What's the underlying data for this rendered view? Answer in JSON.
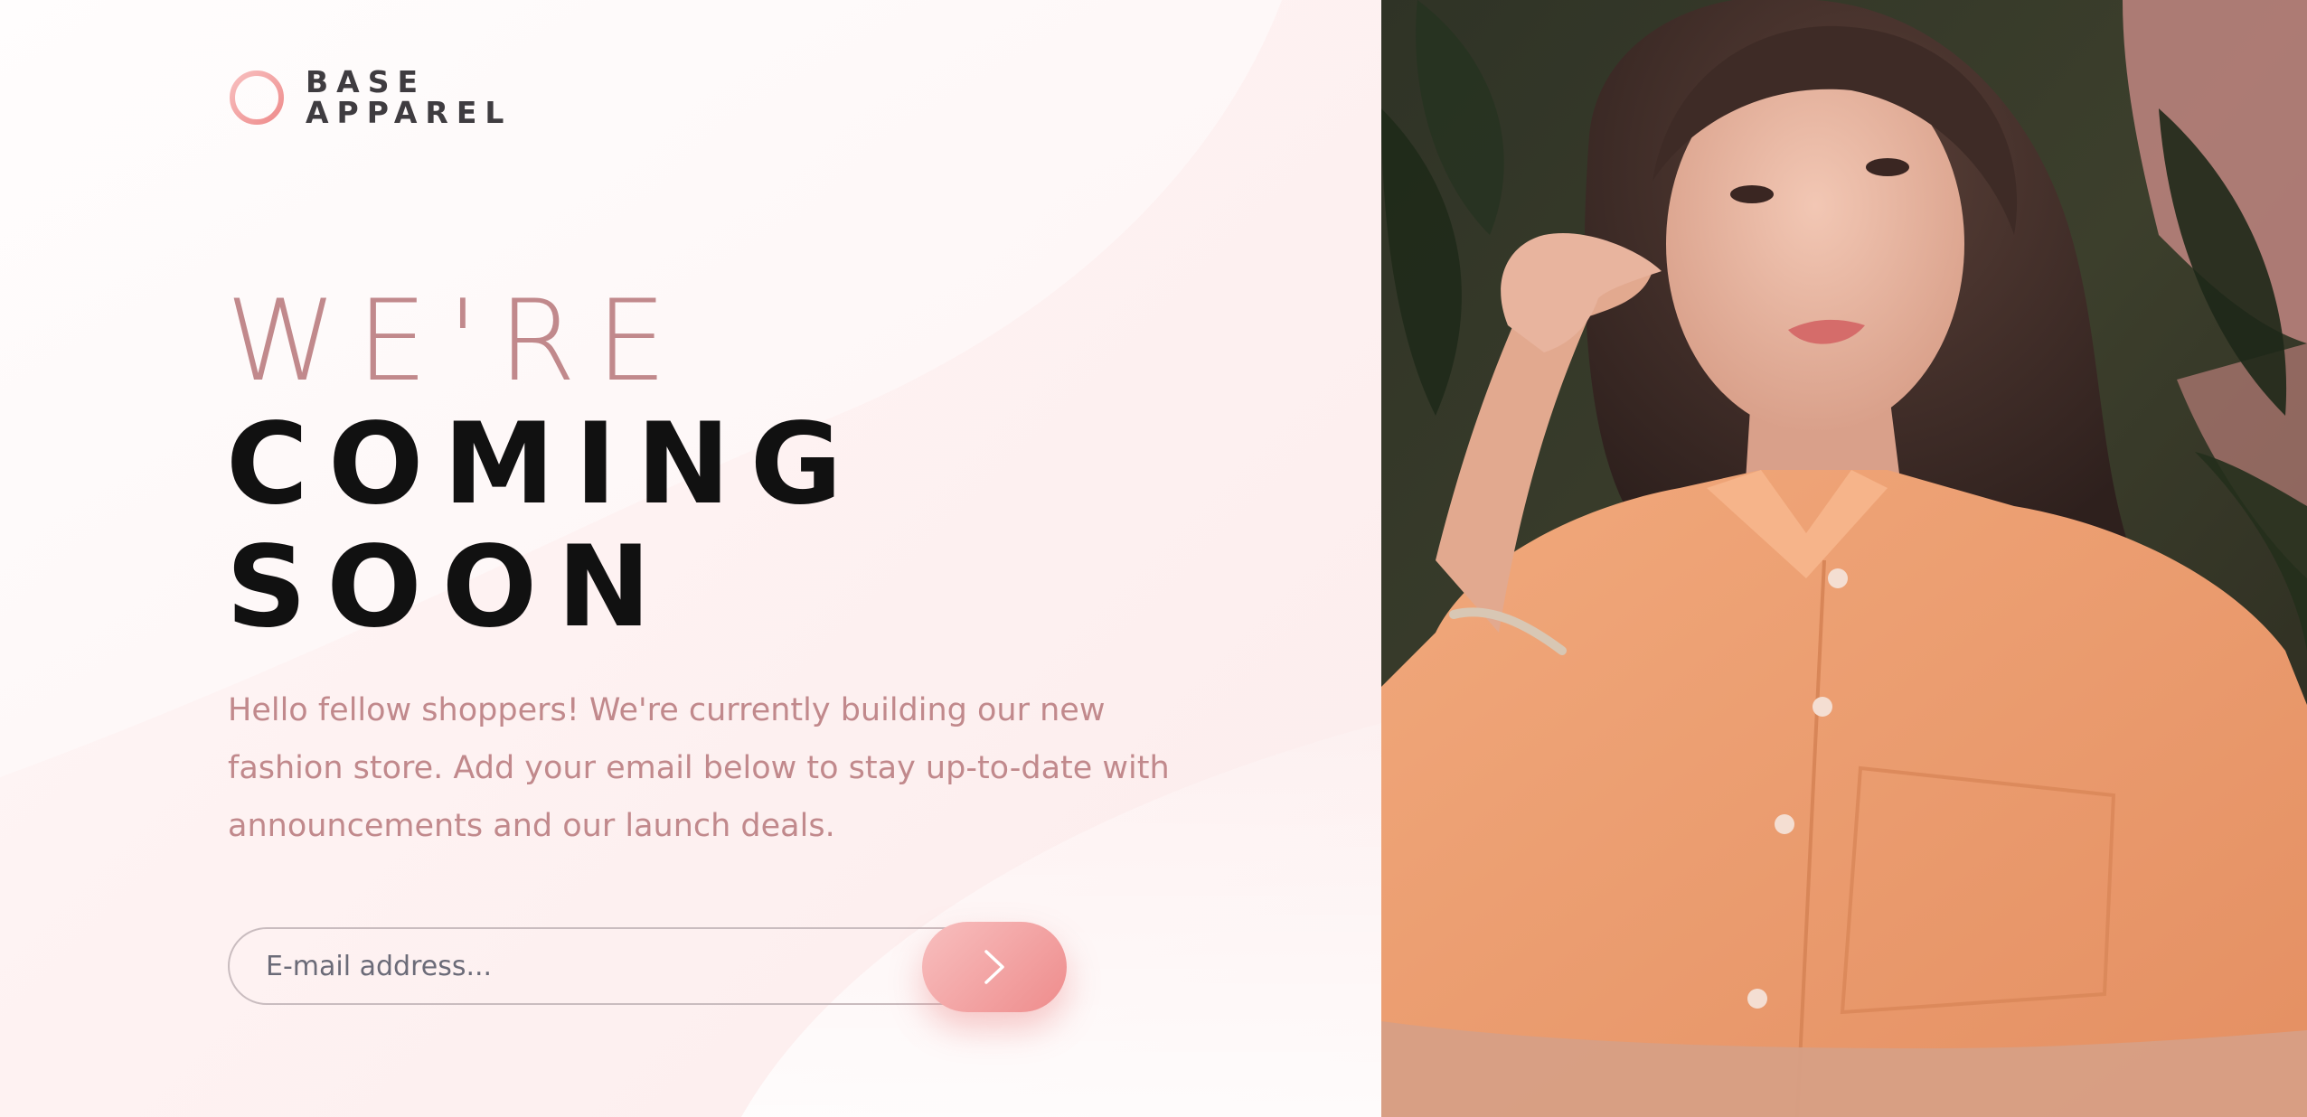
{
  "brand": {
    "line1": "BASE",
    "line2": "APPAREL",
    "logo_icon": "ring-icon"
  },
  "headline": {
    "light": "WE'RE",
    "bold_line1": "COMING",
    "bold_line2": "SOON"
  },
  "description": "Hello fellow shoppers! We're currently building our new fashion store. Add your email below to stay up-to-date with announcements and our launch deals.",
  "form": {
    "email_placeholder": "E-mail address...",
    "email_value": "",
    "submit_icon": "chevron-right-icon"
  },
  "colors": {
    "accent": "#ee8c8c",
    "accent_light": "#f8bfbf",
    "desaturated_red": "#c1898c",
    "dark": "#111111"
  },
  "hero_image": {
    "description_icon": "photo-woman-orange-shirt"
  }
}
